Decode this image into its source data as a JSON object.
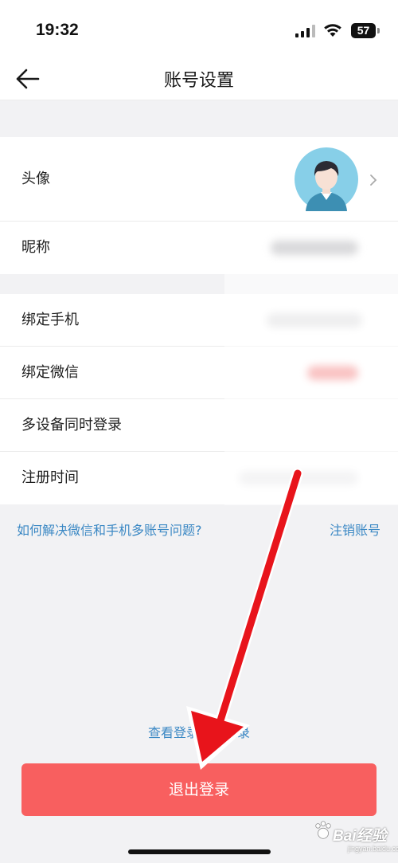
{
  "status_bar": {
    "time": "19:32",
    "battery_level": "57"
  },
  "nav": {
    "title": "账号设置",
    "back_icon": "arrow-left-icon"
  },
  "profile_group": {
    "avatar_label": "头像",
    "nickname_label": "昵称"
  },
  "binding_group": {
    "phone_label": "绑定手机",
    "wechat_label": "绑定微信",
    "multi_device_label": "多设备同时登录",
    "register_time_label": "注册时间"
  },
  "links": {
    "help": "如何解决微信和手机多账号问题?",
    "cancel_account": "注销账号",
    "login_records": "查看登录设备记录"
  },
  "logout_button": "退出登录",
  "watermark": {
    "brand": "Bai经验",
    "url": "jingyan.baidu.com"
  },
  "colors": {
    "accent_link": "#3b88c4",
    "logout_red": "#f85f5f",
    "annotation_red": "#e8141b"
  }
}
